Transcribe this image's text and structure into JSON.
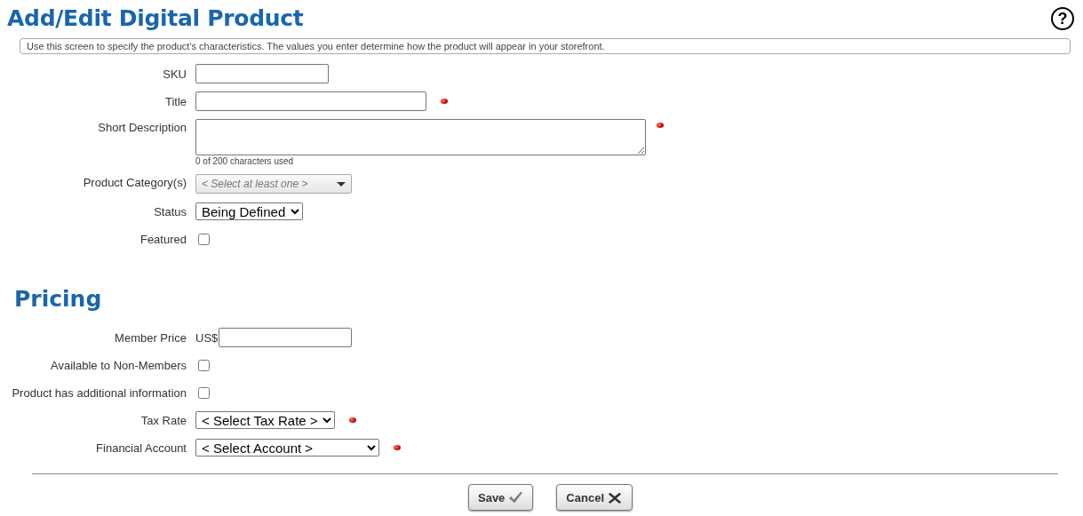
{
  "page_title": "Add/Edit Digital Product",
  "help": "?",
  "intro": "Use this screen to specify the product's characteristics. The values you enter determine how the product will appear in your storefront.",
  "sections": [
    {
      "fields": [
        {
          "kind": "text",
          "label": "SKU",
          "required": false
        },
        {
          "kind": "text",
          "label": "Title",
          "required": true
        },
        {
          "kind": "textarea",
          "label": "Short Description",
          "required": true,
          "counter": "0 of 200 characters used"
        },
        {
          "kind": "picker",
          "label": "Product Category(s)",
          "placeholder": "< Select at least one >",
          "required": false
        },
        {
          "kind": "select",
          "label": "Status",
          "value": "Being Defined",
          "required": false
        },
        {
          "kind": "checkbox",
          "label": "Featured",
          "checked": false
        }
      ]
    },
    {
      "heading": "Pricing",
      "fields": [
        {
          "kind": "text",
          "label": "Member Price",
          "prefix": "US$",
          "required": false
        },
        {
          "kind": "checkbox",
          "label": "Available to Non-Members",
          "checked": false
        },
        {
          "kind": "checkbox",
          "label": "Product has additional information",
          "checked": false
        },
        {
          "kind": "select",
          "label": "Tax Rate",
          "value": "< Select Tax Rate >",
          "required": true
        },
        {
          "kind": "select",
          "label": "Financial Account",
          "value": "< Select Account >",
          "required": true
        }
      ]
    }
  ],
  "buttons": [
    {
      "label": "Save"
    },
    {
      "label": "Cancel"
    }
  ]
}
